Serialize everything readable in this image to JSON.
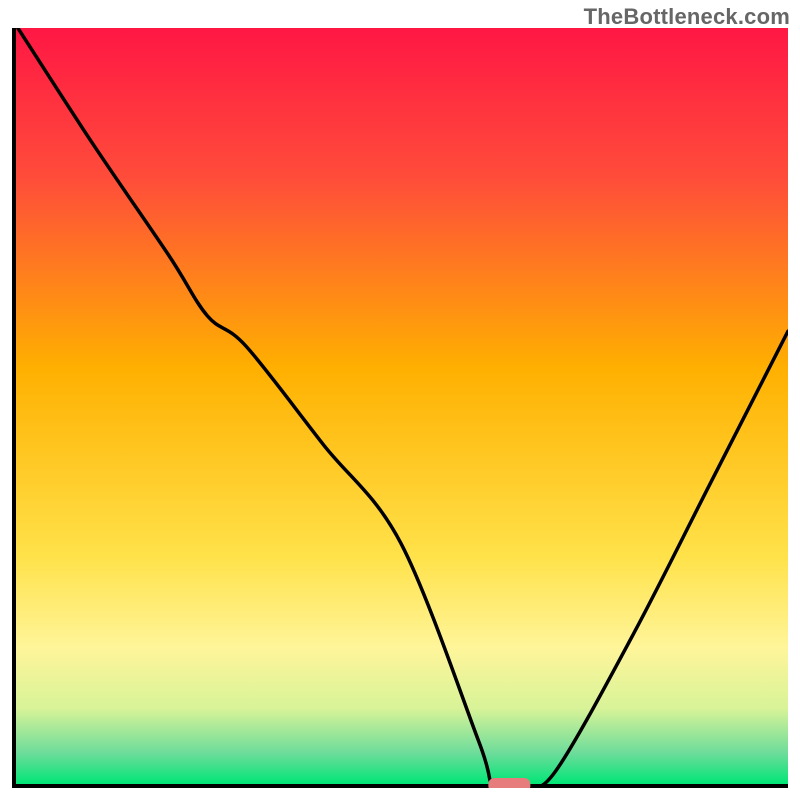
{
  "watermark": {
    "text": "TheBottleneck.com"
  },
  "chart_data": {
    "type": "line",
    "title": "",
    "xlabel": "",
    "ylabel": "",
    "xlim": [
      0,
      100
    ],
    "ylim": [
      0,
      100
    ],
    "grid": false,
    "legend": false,
    "series": [
      {
        "name": "bottleneck-curve",
        "x": [
          0.5,
          10,
          20,
          25,
          30,
          40,
          50,
          60,
          62,
          66,
          70,
          80,
          90,
          100
        ],
        "y": [
          100,
          85,
          70,
          62,
          58,
          45,
          32,
          6,
          0,
          0,
          2,
          20,
          40,
          60
        ]
      }
    ],
    "marker": {
      "name": "optimal-point",
      "x": 64,
      "y": 0,
      "shape": "rounded-rect",
      "color": "#e77c7c"
    },
    "background": {
      "type": "vertical-gradient",
      "stops": [
        {
          "pos": 0.0,
          "color": "#ff1744"
        },
        {
          "pos": 0.2,
          "color": "#ff4d3a"
        },
        {
          "pos": 0.45,
          "color": "#ffb000"
        },
        {
          "pos": 0.7,
          "color": "#ffe24a"
        },
        {
          "pos": 0.82,
          "color": "#fff59a"
        },
        {
          "pos": 0.9,
          "color": "#d8f398"
        },
        {
          "pos": 0.96,
          "color": "#6bdc9a"
        },
        {
          "pos": 1.0,
          "color": "#00e676"
        }
      ]
    },
    "axes": {
      "color": "#000000",
      "width": 4
    }
  }
}
